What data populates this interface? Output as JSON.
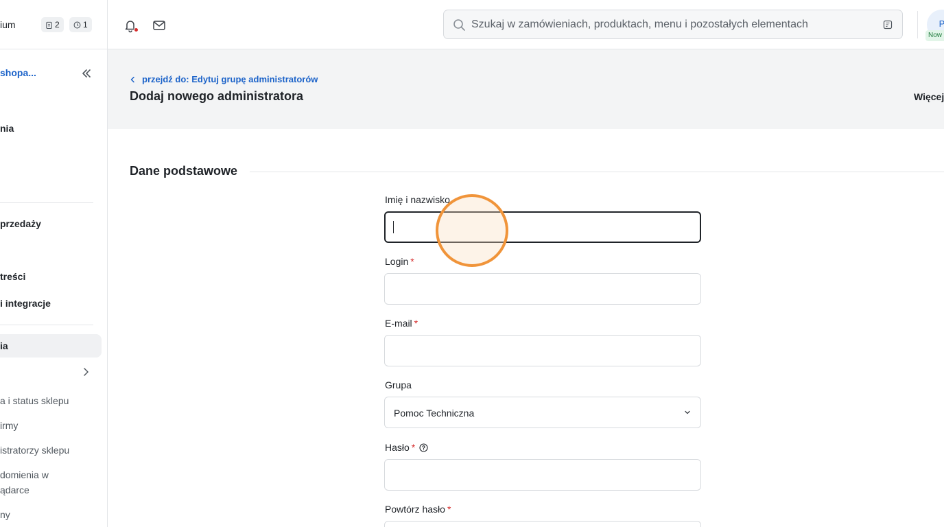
{
  "sidebar": {
    "plan_label": "ium",
    "badge_tasks": "2",
    "badge_pending": "1",
    "shop_name": "shopa...",
    "items": [
      {
        "label": "nia"
      },
      {
        "label": "przedaży"
      },
      {
        "label": "treści"
      },
      {
        "label": "i integracje"
      },
      {
        "label": "ia"
      }
    ],
    "subitems": [
      {
        "label": "a i status sklepu"
      },
      {
        "label": "irmy"
      },
      {
        "label": "istratorzy sklepu"
      },
      {
        "label": "domienia w"
      },
      {
        "label": "ądarce"
      },
      {
        "label": "ny"
      }
    ]
  },
  "topbar": {
    "search_placeholder": "Szukaj w zamówieniach, produktach, menu i pozostałych elementach",
    "avatar_initial": "P",
    "new_badge": "Now"
  },
  "header": {
    "back_link": "przejdź do: Edytuj grupę administratorów",
    "title": "Dodaj nowego administratora",
    "more_label": "Więcej"
  },
  "form": {
    "section_title": "Dane podstawowe",
    "name_label": "Imię i nazwisko",
    "login_label": "Login",
    "email_label": "E-mail",
    "group_label": "Grupa",
    "group_value": "Pomoc Techniczna",
    "password_label": "Hasło",
    "repeat_password_label": "Powtórz hasło",
    "required_mark": "*"
  }
}
